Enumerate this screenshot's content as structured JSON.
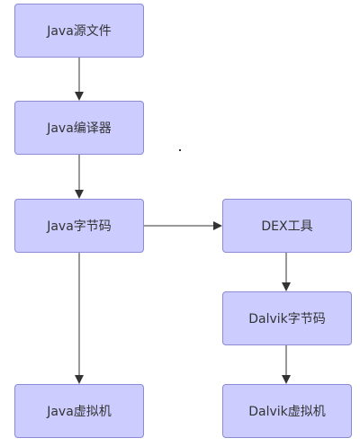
{
  "diagram": {
    "nodes": {
      "java_source": "Java源文件",
      "java_compiler": "Java编译器",
      "java_bytecode": "Java字节码",
      "java_vm": "Java虚拟机",
      "dex_tool": "DEX工具",
      "dalvik_bytecode": "Dalvik字节码",
      "dalvik_vm": "Dalvik虚拟机"
    },
    "edges": [
      {
        "from": "java_source",
        "to": "java_compiler"
      },
      {
        "from": "java_compiler",
        "to": "java_bytecode"
      },
      {
        "from": "java_bytecode",
        "to": "dex_tool"
      },
      {
        "from": "java_bytecode",
        "to": "java_vm"
      },
      {
        "from": "dex_tool",
        "to": "dalvik_bytecode"
      },
      {
        "from": "dalvik_bytecode",
        "to": "dalvik_vm"
      }
    ],
    "colors": {
      "node_fill": "#ccccff",
      "node_border": "#8a8ad6",
      "edge": "#333333"
    }
  }
}
